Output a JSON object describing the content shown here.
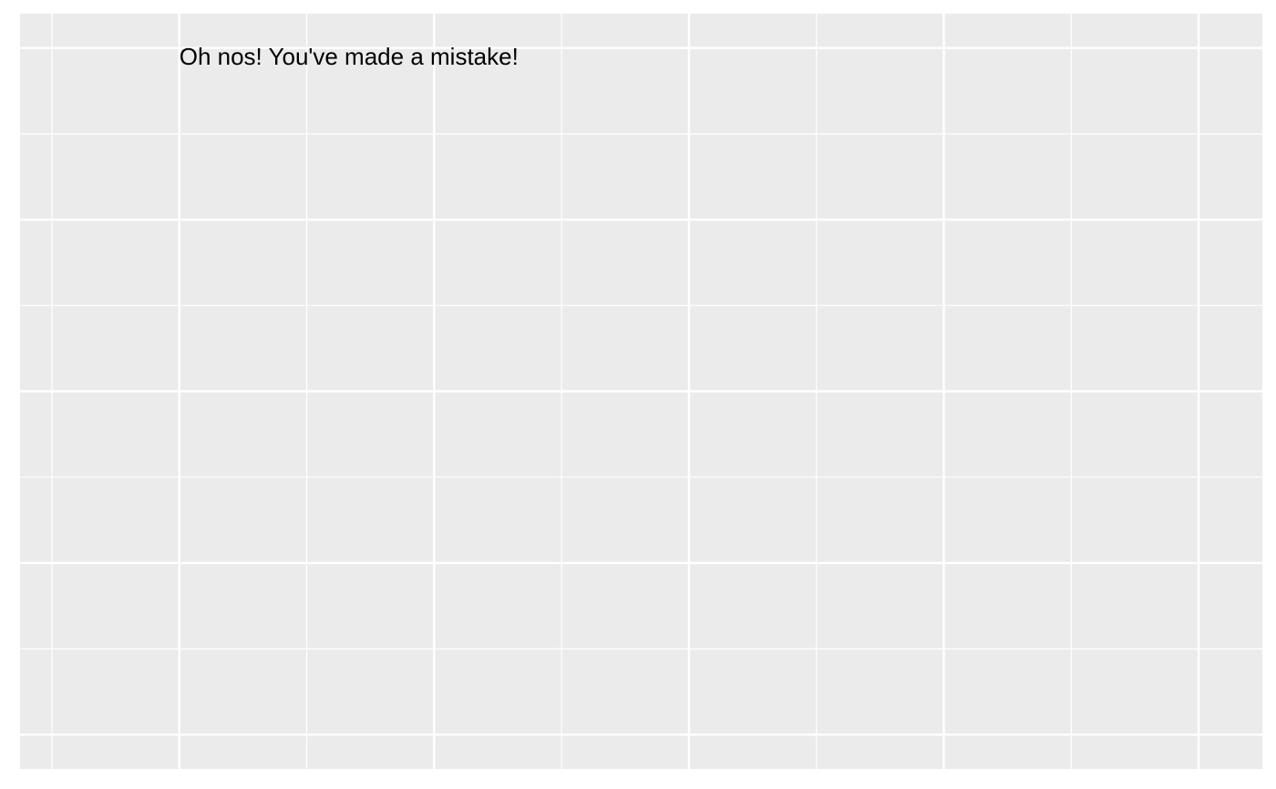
{
  "chart_data": {
    "type": "scatter",
    "title": "",
    "xlabel": "",
    "ylabel": "",
    "xlim": [
      -0.25,
      9.5
    ],
    "ylim": [
      0,
      8.8
    ],
    "x_breaks": [
      0,
      1,
      2,
      3,
      4,
      5,
      6,
      7,
      8,
      9
    ],
    "y_breaks": [
      0.4,
      1.4,
      2.4,
      3.4,
      4.4,
      5.4,
      6.4,
      7.4,
      8.4
    ],
    "grid": true,
    "legend": "none",
    "annotation": {
      "text": "Oh nos! You've made a mistake!",
      "x": 1,
      "y": 8.3
    },
    "colors": {
      "panel_background": "#EBEBEB",
      "grid": "#FFFFFF",
      "text": "#000000"
    }
  }
}
